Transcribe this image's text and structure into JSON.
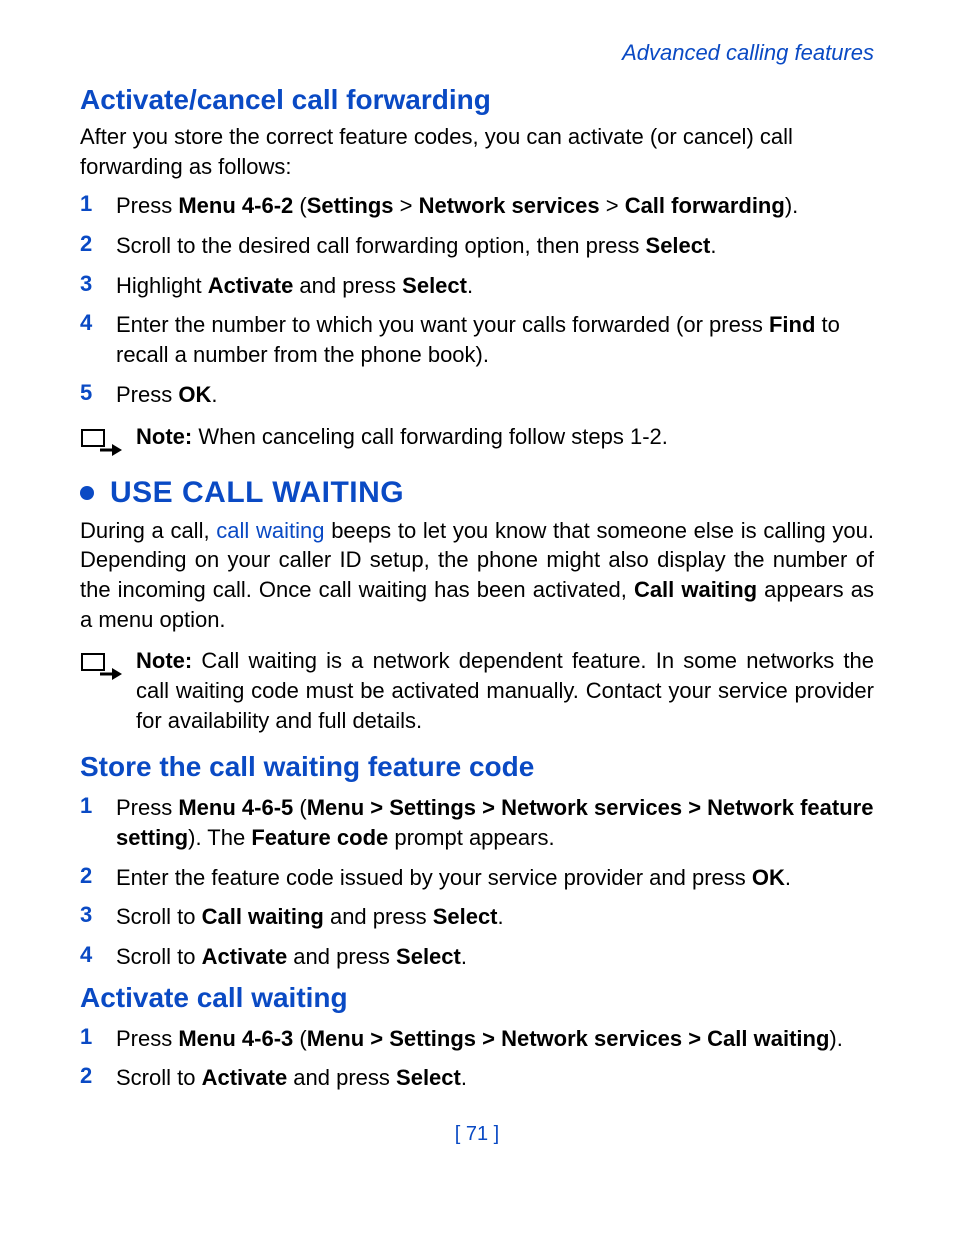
{
  "runhead": "Advanced calling features",
  "sectA": {
    "title": "Activate/cancel call forwarding",
    "intro": "After you store the correct feature codes, you can activate (or cancel) call forwarding as follows:",
    "steps": [
      {
        "pre": "Press ",
        "b1": "Menu 4-6-2",
        "mid1": " (",
        "b2": "Settings",
        "mid2": " > ",
        "b3": "Network services",
        "mid3": " > ",
        "b4": "Call forwarding",
        "tail": ")."
      },
      {
        "pre": "Scroll to the desired call forwarding option, then press ",
        "b1": "Select",
        "tail": "."
      },
      {
        "pre": "Highlight ",
        "b1": "Activate",
        "mid1": " and press ",
        "b2": "Select",
        "tail": "."
      },
      {
        "pre": "Enter the number to which you want your calls forwarded (or press ",
        "b1": "Find",
        "tail": " to recall a number from the phone book)."
      },
      {
        "pre": "Press ",
        "b1": "OK",
        "tail": "."
      }
    ],
    "note": {
      "label": "Note:",
      "text": "  When canceling call forwarding follow steps 1-2."
    }
  },
  "sectB": {
    "title": "USE CALL WAITING",
    "intro_pre": "During a call, ",
    "intro_term": "call waiting",
    "intro_mid": " beeps to let you know that someone else is calling you. Depending on your caller ID setup, the phone might also display the number of the incoming call. Once call waiting has been activated, ",
    "intro_bold": "Call waiting",
    "intro_tail": " appears as a menu option.",
    "note": {
      "label": "Note:",
      "text": "  Call waiting is a network dependent feature. In some networks the call waiting code must be activated manually. Contact your service provider for availability and full details."
    }
  },
  "sectC": {
    "title": "Store the call waiting feature code",
    "steps": [
      {
        "pre": "Press ",
        "b1": "Menu 4-6-5",
        "mid1": " (",
        "b2": "Menu > Settings > Network services > Network feature setting",
        "mid2": "). The ",
        "b3": "Feature code",
        "tail": " prompt appears."
      },
      {
        "pre": "Enter the feature code issued by your service provider and press ",
        "b1": "OK",
        "tail": "."
      },
      {
        "pre": "Scroll to ",
        "b1": "Call waiting",
        "mid1": " and press ",
        "b2": "Select",
        "tail": "."
      },
      {
        "pre": "Scroll to ",
        "b1": "Activate",
        "mid1": " and press ",
        "b2": "Select",
        "tail": "."
      }
    ]
  },
  "sectD": {
    "title": "Activate call waiting",
    "steps": [
      {
        "pre": "Press ",
        "b1": "Menu 4-6-3",
        "mid1": " (",
        "b2": "Menu > Settings > Network services > Call waiting",
        "tail": ")."
      },
      {
        "pre": "Scroll to ",
        "b1": "Activate",
        "mid1": " and press ",
        "b2": "Select",
        "tail": "."
      }
    ]
  },
  "pagenum": "[ 71 ]"
}
